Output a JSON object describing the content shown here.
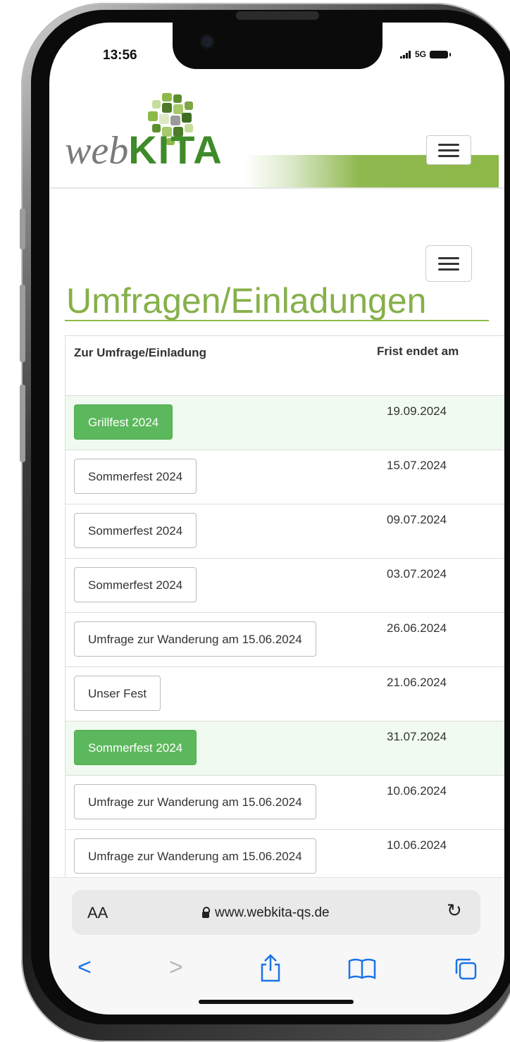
{
  "status_bar": {
    "time": "13:56",
    "network": "5G",
    "signal_icon": "cellular-signal-icon",
    "battery_icon": "battery-icon"
  },
  "site": {
    "logo_web": "web",
    "logo_kita": "KITA",
    "menu_icon": "hamburger-menu-icon"
  },
  "page": {
    "title": "Umfragen/Einladungen",
    "table": {
      "header_name": "Zur Umfrage/Einladung",
      "header_date": "Frist endet am",
      "rows": [
        {
          "label": "Grillfest 2024",
          "date": "19.09.2024",
          "highlight": true
        },
        {
          "label": "Sommerfest 2024",
          "date": "15.07.2024",
          "highlight": false
        },
        {
          "label": "Sommerfest 2024",
          "date": "09.07.2024",
          "highlight": false
        },
        {
          "label": "Sommerfest 2024",
          "date": "03.07.2024",
          "highlight": false
        },
        {
          "label": "Umfrage zur Wanderung am 15.06.2024",
          "date": "26.06.2024",
          "highlight": false
        },
        {
          "label": "Unser Fest",
          "date": "21.06.2024",
          "highlight": false
        },
        {
          "label": "Sommerfest 2024",
          "date": "31.07.2024",
          "highlight": true
        },
        {
          "label": "Umfrage zur Wanderung am 15.06.2024",
          "date": "10.06.2024",
          "highlight": false
        },
        {
          "label": "Umfrage zur Wanderung am 15.06.2024",
          "date": "10.06.2024",
          "highlight": false
        }
      ]
    }
  },
  "browser": {
    "aa_label": "AA",
    "url": "www.webkita-qs.de",
    "icons": [
      "back-icon",
      "forward-icon",
      "share-icon",
      "bookmarks-icon",
      "tabs-icon",
      "reload-icon",
      "lock-icon"
    ]
  },
  "colors": {
    "brand_green": "#86b04a",
    "button_green": "#5cb85c",
    "link_blue": "#1a73e8"
  }
}
